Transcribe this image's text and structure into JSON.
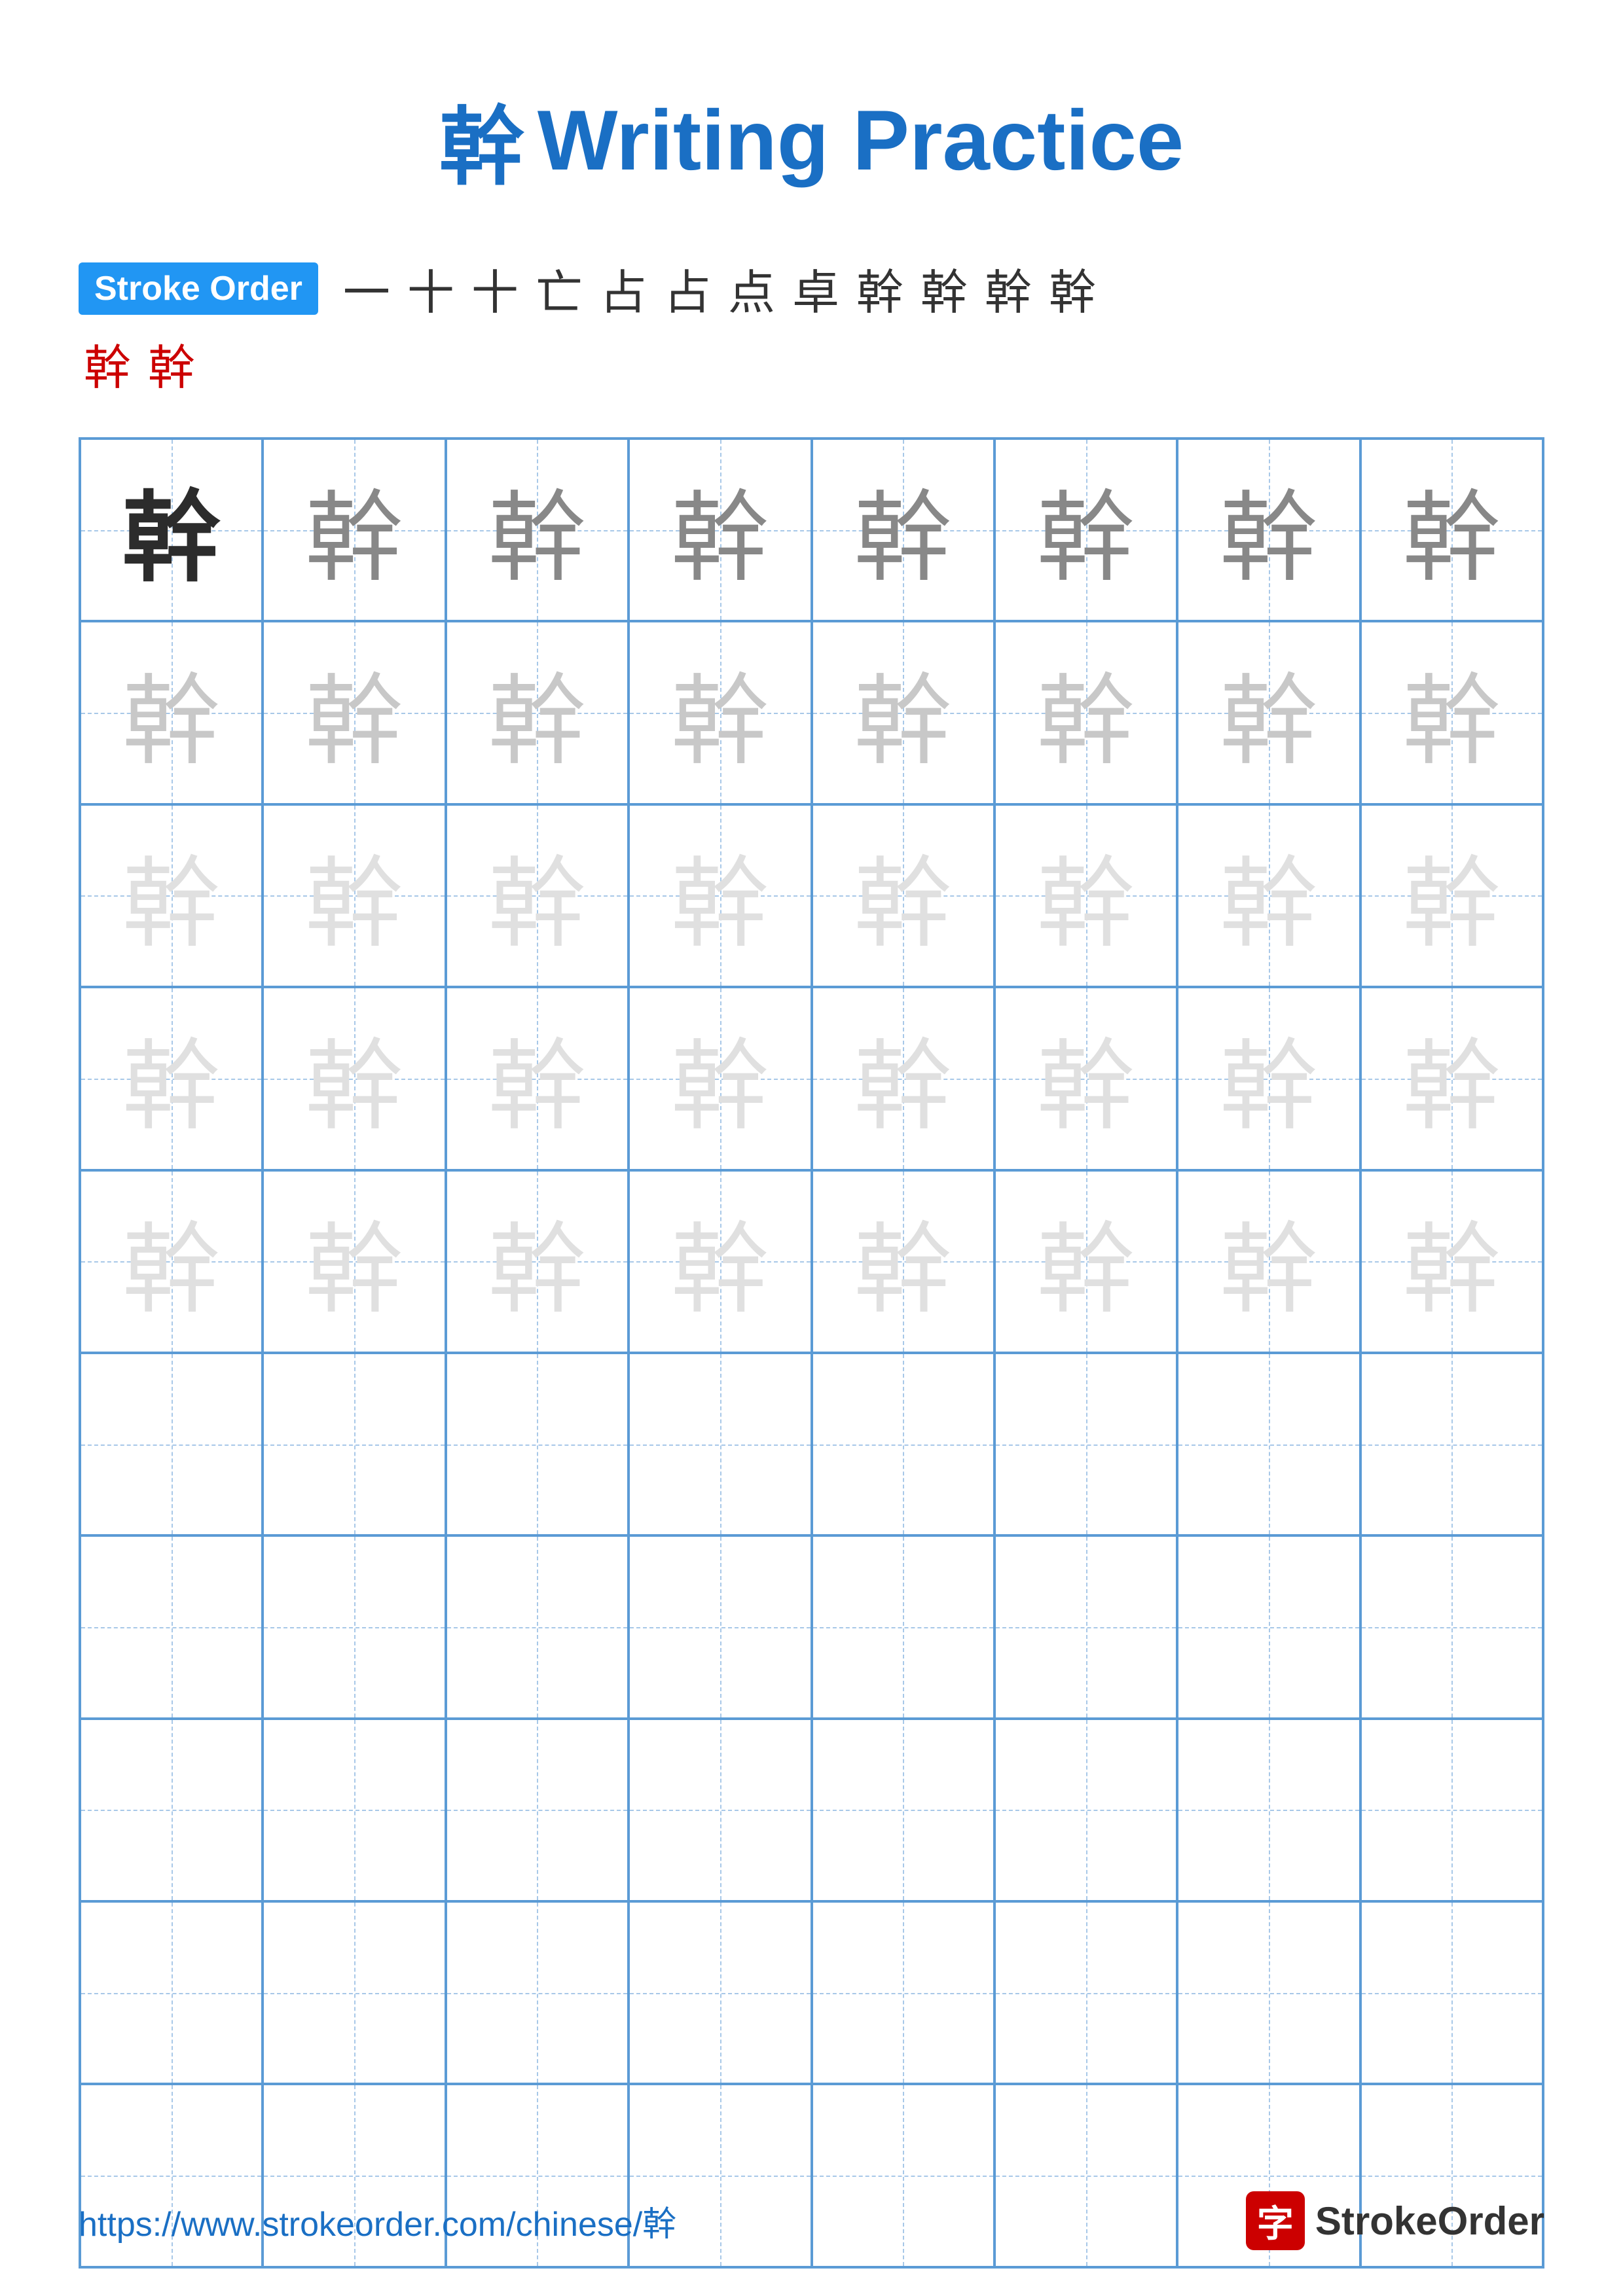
{
  "title": {
    "char": "幹",
    "text": "Writing Practice",
    "full": "幹 Writing Practice"
  },
  "stroke_order": {
    "badge_label": "Stroke Order",
    "strokes_row1": [
      "一",
      "十",
      "十",
      "亡",
      "占",
      "占",
      "点",
      "卓",
      "幹",
      "幹",
      "幹",
      "幹"
    ],
    "strokes_row2": [
      "幹",
      "幹"
    ]
  },
  "grid": {
    "character": "幹",
    "rows": 10,
    "cols": 8,
    "cells": [
      [
        "dark",
        "medium",
        "medium",
        "medium",
        "medium",
        "medium",
        "medium",
        "medium"
      ],
      [
        "light",
        "light",
        "light",
        "light",
        "light",
        "light",
        "light",
        "light"
      ],
      [
        "very-light",
        "very-light",
        "very-light",
        "very-light",
        "very-light",
        "very-light",
        "very-light",
        "very-light"
      ],
      [
        "very-light",
        "very-light",
        "very-light",
        "very-light",
        "very-light",
        "very-light",
        "very-light",
        "very-light"
      ],
      [
        "very-light",
        "very-light",
        "very-light",
        "very-light",
        "very-light",
        "very-light",
        "very-light",
        "very-light"
      ],
      [
        "empty",
        "empty",
        "empty",
        "empty",
        "empty",
        "empty",
        "empty",
        "empty"
      ],
      [
        "empty",
        "empty",
        "empty",
        "empty",
        "empty",
        "empty",
        "empty",
        "empty"
      ],
      [
        "empty",
        "empty",
        "empty",
        "empty",
        "empty",
        "empty",
        "empty",
        "empty"
      ],
      [
        "empty",
        "empty",
        "empty",
        "empty",
        "empty",
        "empty",
        "empty",
        "empty"
      ],
      [
        "empty",
        "empty",
        "empty",
        "empty",
        "empty",
        "empty",
        "empty",
        "empty"
      ]
    ]
  },
  "footer": {
    "url": "https://www.strokeorder.com/chinese/幹",
    "brand_icon": "字",
    "brand_name": "StrokeOrder"
  }
}
